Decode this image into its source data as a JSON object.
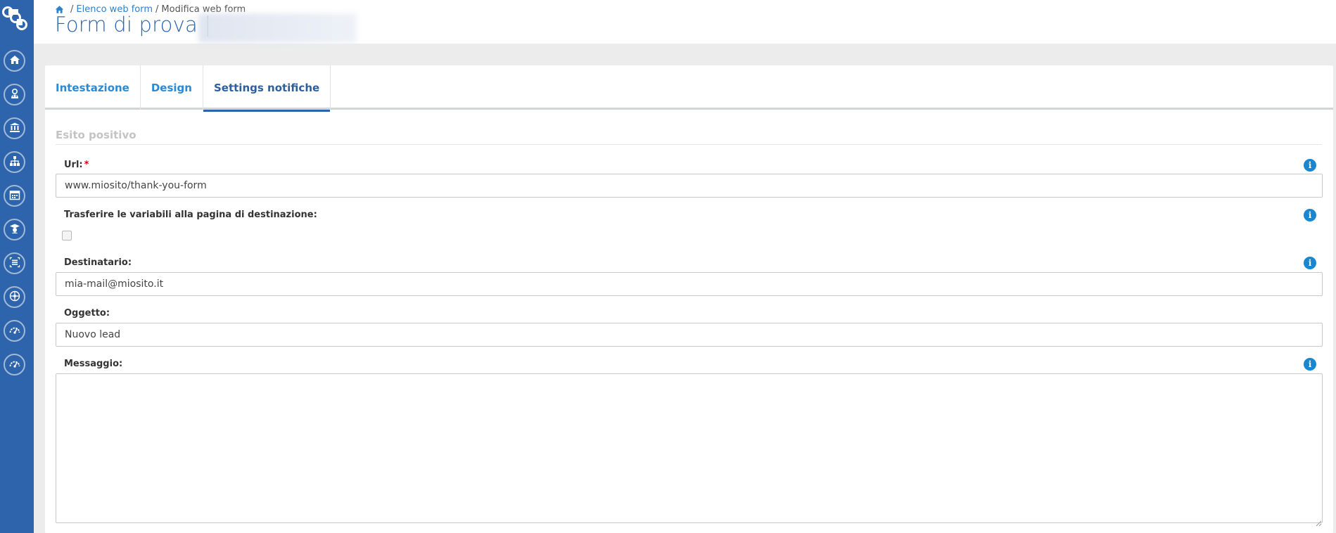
{
  "breadcrumb": {
    "separator": "/",
    "link_label": "Elenco web form",
    "current_label": "Modifica web form"
  },
  "page": {
    "title": "Form di prova |"
  },
  "sidebar": {
    "items": [
      {
        "icon": "home-icon"
      },
      {
        "icon": "doctor-icon"
      },
      {
        "icon": "institution-icon"
      },
      {
        "icon": "hierarchy-icon"
      },
      {
        "icon": "calendar-icon"
      },
      {
        "icon": "graduation-icon"
      },
      {
        "icon": "list-icon"
      },
      {
        "icon": "network-icon"
      },
      {
        "icon": "gauge-icon"
      },
      {
        "icon": "gauge-icon"
      }
    ]
  },
  "tabs": [
    {
      "label": "Intestazione"
    },
    {
      "label": "Design"
    },
    {
      "label": "Settings notifiche",
      "active": true
    }
  ],
  "form": {
    "section_title": "Esito positivo",
    "url": {
      "label": "Url:",
      "required_mark": "*",
      "value": "www.miosito/thank-you-form"
    },
    "transfer": {
      "label": "Trasferire le variabili alla pagina di destinazione:",
      "checked": false
    },
    "recipient": {
      "label": "Destinatario:",
      "value": "mia-mail@miosito.it"
    },
    "subject": {
      "label": "Oggetto:",
      "value": "Nuovo lead"
    },
    "message": {
      "label": "Messaggio:",
      "value": ""
    },
    "info_glyph": "i"
  },
  "colors": {
    "sidebar": "#2d64ab",
    "accent": "#2a8ad4",
    "info": "#1a86d0",
    "required": "#d0021b"
  }
}
